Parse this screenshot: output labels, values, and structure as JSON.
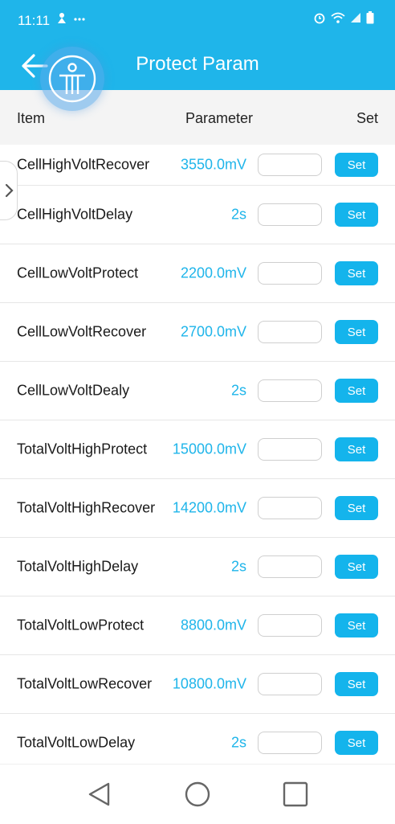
{
  "status_bar": {
    "time": "11:11",
    "left_icons": [
      "notification-icon",
      "more-icon"
    ],
    "right_icons": [
      "alarm-icon",
      "wifi-icon",
      "signal-icon",
      "battery-icon"
    ]
  },
  "header": {
    "title": "Protect Param",
    "back_icon": "arrow-left-icon",
    "accessibility_icon": "accessibility-icon"
  },
  "columns": {
    "item": "Item",
    "parameter": "Parameter",
    "set": "Set"
  },
  "rows": [
    {
      "name": "CellHighVoltRecover",
      "value": "3550.0mV",
      "input": "",
      "button": "Set"
    },
    {
      "name": "CellHighVoltDelay",
      "value": "2s",
      "input": "",
      "button": "Set"
    },
    {
      "name": "CellLowVoltProtect",
      "value": "2200.0mV",
      "input": "",
      "button": "Set"
    },
    {
      "name": "CellLowVoltRecover",
      "value": "2700.0mV",
      "input": "",
      "button": "Set"
    },
    {
      "name": "CellLowVoltDealy",
      "value": "2s",
      "input": "",
      "button": "Set"
    },
    {
      "name": "TotalVoltHighProtect",
      "value": "15000.0mV",
      "input": "",
      "button": "Set"
    },
    {
      "name": "TotalVoltHighRecover",
      "value": "14200.0mV",
      "input": "",
      "button": "Set"
    },
    {
      "name": "TotalVoltHighDelay",
      "value": "2s",
      "input": "",
      "button": "Set"
    },
    {
      "name": "TotalVoltLowProtect",
      "value": "8800.0mV",
      "input": "",
      "button": "Set"
    },
    {
      "name": "TotalVoltLowRecover",
      "value": "10800.0mV",
      "input": "",
      "button": "Set"
    },
    {
      "name": "TotalVoltLowDelay",
      "value": "2s",
      "input": "",
      "button": "Set"
    }
  ],
  "side_tab_icon": "chevron-right-icon",
  "nav_bar": {
    "back": "triangle-back-icon",
    "home": "circle-home-icon",
    "recents": "square-recents-icon"
  },
  "colors": {
    "accent": "#1fb5ea",
    "button": "#14b4ec"
  }
}
